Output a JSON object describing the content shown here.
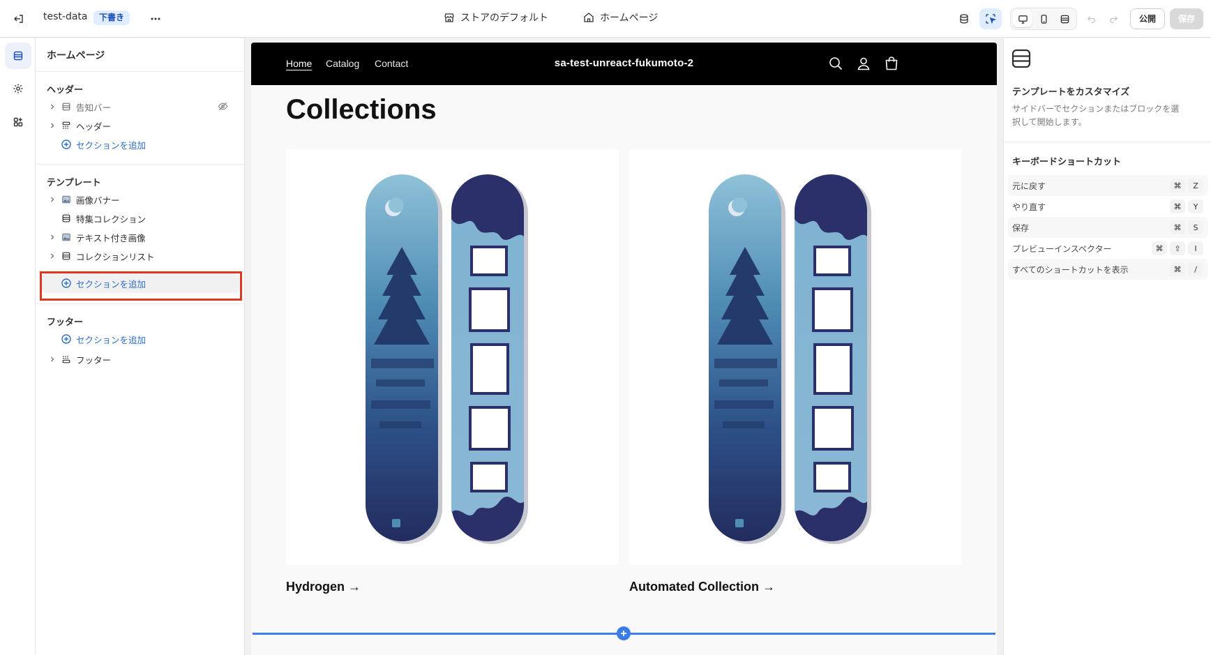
{
  "topbar": {
    "theme_name": "test-data",
    "status_badge": "下書き",
    "template_selector": "ストアのデフォルト",
    "page_selector": "ホームページ",
    "publish_label": "公開",
    "save_label": "保存"
  },
  "sidebar": {
    "title": "ホームページ",
    "groups": {
      "header": {
        "label": "ヘッダー",
        "items": [
          "告知バー",
          "ヘッダー"
        ],
        "add_section": "セクションを追加"
      },
      "template": {
        "label": "テンプレート",
        "items": [
          "画像バナー",
          "特集コレクション",
          "テキスト付き画像",
          "コレクションリスト"
        ],
        "add_section": "セクションを追加"
      },
      "footer": {
        "label": "フッター",
        "add_section": "セクションを追加",
        "items": [
          "フッター"
        ]
      }
    }
  },
  "preview": {
    "nav_links": [
      "Home",
      "Catalog",
      "Contact"
    ],
    "store_name": "sa-test-unreact-fukumoto-2",
    "section_title": "Collections",
    "collections": [
      {
        "label": "Hydrogen →"
      },
      {
        "label": "Automated Collection →"
      }
    ]
  },
  "right_panel": {
    "title": "テンプレートをカスタマイズ",
    "description": "サイドバーでセクションまたはブロックを選択して開始します。",
    "shortcuts_title": "キーボードショートカット",
    "shortcuts": [
      {
        "label": "元に戻す",
        "keys": [
          "⌘",
          "Z"
        ]
      },
      {
        "label": "やり直す",
        "keys": [
          "⌘",
          "Y"
        ]
      },
      {
        "label": "保存",
        "keys": [
          "⌘",
          "S"
        ]
      },
      {
        "label": "プレビューインスペクター",
        "keys": [
          "⌘",
          "⇧",
          "I"
        ]
      },
      {
        "label": "すべてのショートカットを表示",
        "keys": [
          "⌘",
          "/"
        ]
      }
    ]
  },
  "colors": {
    "accent": "#2c6ecb",
    "highlight": "#e0381f",
    "insert_line": "#3b7ce8",
    "store_nav_bg": "#000000"
  }
}
